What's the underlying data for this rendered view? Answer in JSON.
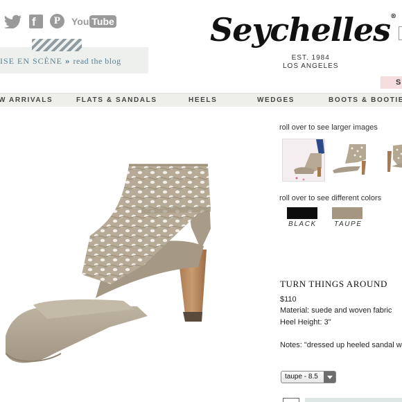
{
  "header": {
    "social": {
      "facebook_glyph": "f",
      "pinterest_glyph": "P",
      "youtube_you": "You",
      "youtube_tube": "Tube"
    },
    "blog": {
      "mise": "ISE EN SCÈNE",
      "arrows": "»",
      "read": "read the blog"
    },
    "logo": "Seychelles",
    "logo_mark": "®",
    "est_line1": "EST. 1984",
    "est_line2": "LOS ANGELES",
    "sign_tab": "S"
  },
  "nav": {
    "items": [
      "W ARRIVALS",
      "FLATS & SANDALS",
      "HEELS",
      "WEDGES",
      "BOOTS & BOOTIES"
    ]
  },
  "product": {
    "images_caption": "roll over to see larger images",
    "colors_caption": "roll over to see different colors",
    "colors": [
      {
        "label": "BLACK",
        "hex": "#0d0d0d"
      },
      {
        "label": "TAUPE",
        "hex": "#a5977f"
      }
    ],
    "title": "TURN THINGS AROUND",
    "price": "$110",
    "material": "Material: suede and woven fabric",
    "heel_height": "Heel Height: 3\"",
    "notes": "Notes: \"dressed up heeled sandal wit",
    "size_select": "taupe - 8.5"
  },
  "colors": {
    "nav_bg": "#eeeeea",
    "blog_text": "#5a7f90",
    "suede": "#b3a996"
  }
}
